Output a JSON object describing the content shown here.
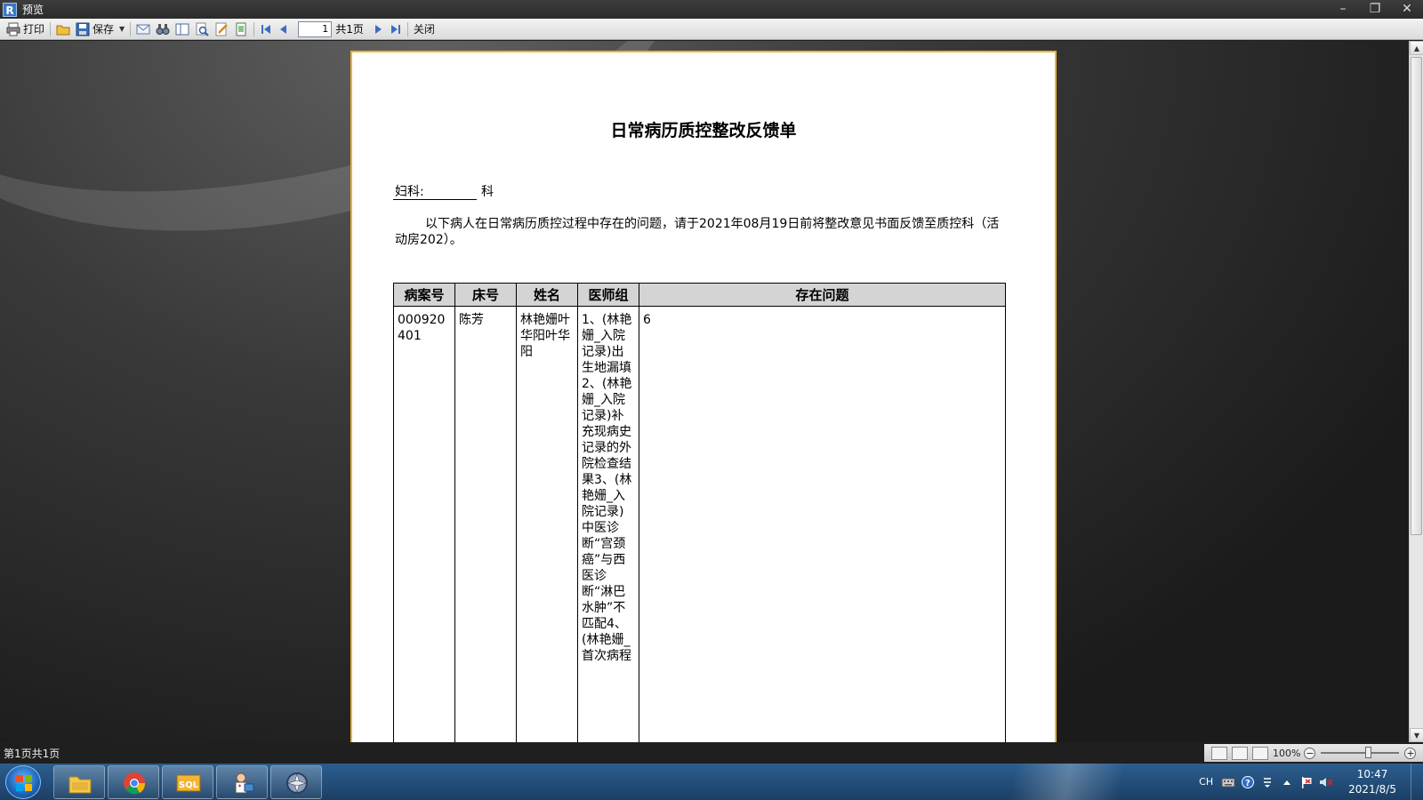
{
  "window": {
    "title": "预览",
    "app_icon": "R",
    "controls": {
      "minimize": "–",
      "restore": "❐",
      "close": "✕"
    }
  },
  "toolbar": {
    "print_label": "打印",
    "save_label": "保存",
    "page_value": "1",
    "total_pages": "共1页",
    "close_label": "关闭"
  },
  "document": {
    "title": "日常病历质控整改反馈单",
    "dept_label": "妇科:",
    "dept_suffix": "科",
    "notice": "以下病人在日常病历质控过程中存在的问题，请于2021年08月19日前将整改意见书面反馈至质控科（活动房202）。",
    "table": {
      "headers": [
        "病案号",
        "床号",
        "姓名",
        "医师组",
        "存在问题"
      ],
      "row": {
        "case_no": "000920401",
        "bed_no": "陈芳",
        "name": "林艳姗叶华阳叶华阳",
        "doctor_group": "1、(林艳姗_入院记录)出生地漏填2、(林艳姗_入院记录)补充现病史记录的外院检查结果3、(林艳姗_入院记录)中医诊断“宫颈癌”与西医诊断“淋巴水肿”不匹配4、(林艳姗_首次病程",
        "issues": "6"
      }
    }
  },
  "statusbar": {
    "page_info": "第1页共1页",
    "zoom": "100%"
  },
  "taskbar": {
    "tray": {
      "lang": "CH"
    },
    "clock": {
      "time": "10:47",
      "date": "2021/8/5"
    }
  },
  "colors": {
    "page_border": "#f0b030",
    "header_bg": "#d4d4d4",
    "taskbar": "#1b3f66"
  }
}
